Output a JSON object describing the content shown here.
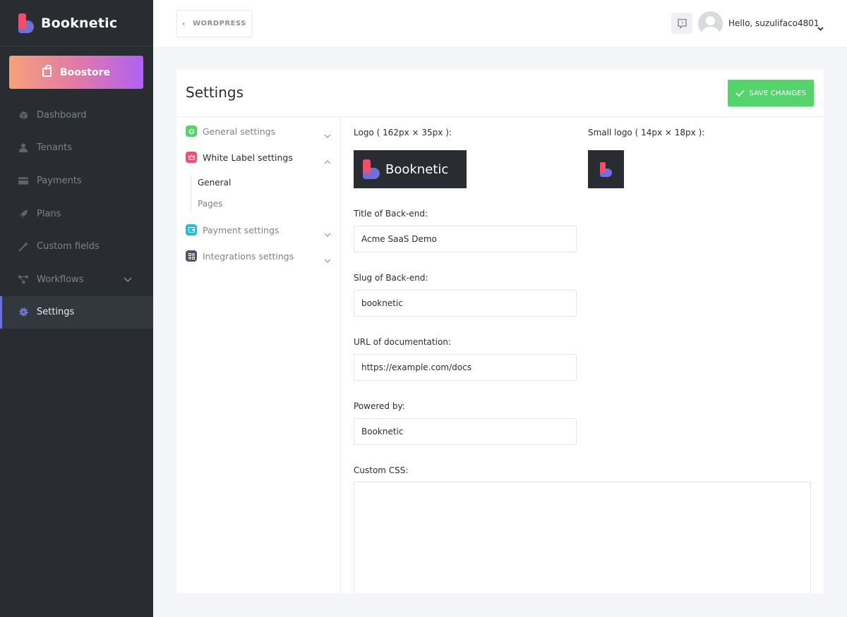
{
  "brand": {
    "name": "Booknetic"
  },
  "boostore": {
    "label": "Boostore"
  },
  "sidebar": {
    "items": [
      {
        "label": "Dashboard",
        "icon": "cube-icon"
      },
      {
        "label": "Tenants",
        "icon": "user-icon"
      },
      {
        "label": "Payments",
        "icon": "credit-card-icon"
      },
      {
        "label": "Plans",
        "icon": "rocket-icon"
      },
      {
        "label": "Custom fields",
        "icon": "magic-wand-icon"
      },
      {
        "label": "Workflows",
        "icon": "workflow-icon"
      },
      {
        "label": "Settings",
        "icon": "gear-icon"
      }
    ]
  },
  "topbar": {
    "back_label": "WORDPRESS",
    "user_greeting": "Hello, suzulifaco4801"
  },
  "page": {
    "title": "Settings",
    "save_label": "SAVE CHANGES"
  },
  "settings_menu": {
    "items": [
      {
        "label": "General settings",
        "color": "#53d56c"
      },
      {
        "label": "White Label settings",
        "color": "#f04e6d"
      },
      {
        "label": "Payment settings",
        "color": "#2fb9d6"
      },
      {
        "label": "Integrations settings",
        "color": "#4d5562"
      }
    ],
    "sub_items": [
      "General",
      "Pages"
    ]
  },
  "form": {
    "logo_label": "Logo ( 162px × 35px ):",
    "small_logo_label": "Small logo ( 14px × 18px ):",
    "logo_text": "Booknetic",
    "title_label": "Title of Back-end:",
    "title_value": "Acme SaaS Demo",
    "slug_label": "Slug of Back-end:",
    "slug_value": "booknetic",
    "docs_label": "URL of documentation:",
    "docs_value": "https://example.com/docs",
    "powered_label": "Powered by:",
    "powered_value": "Booknetic",
    "css_label": "Custom CSS:",
    "css_value": ""
  },
  "colors": {
    "sidebar_bg": "#292d32",
    "accent": "#6c70dc",
    "save_green": "#53d56c",
    "brand_pink": "#f04e6d"
  }
}
